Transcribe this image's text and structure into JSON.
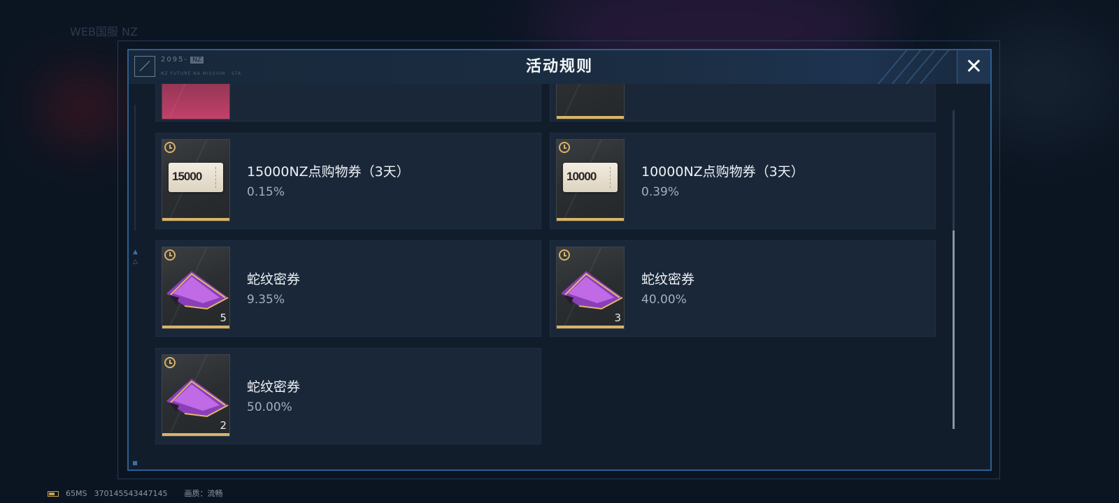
{
  "background": {
    "hint_text": "WEB国服 NZ"
  },
  "dialog": {
    "logo_text": "2095-",
    "logo_tag": "NZ",
    "logo_sub": "NZ FUTURE NA MISSION · STA",
    "title": "活动规则",
    "close_icon": "close-icon"
  },
  "rewards": [
    {
      "name": "15000NZ点购物券（3天）",
      "rate": "0.15%",
      "icon": "voucher-15000",
      "voucher_text": "15000"
    },
    {
      "name": "10000NZ点购物券（3天）",
      "rate": "0.39%",
      "icon": "voucher-10000",
      "voucher_text": "10000"
    },
    {
      "name": "蛇纹密券",
      "rate": "9.35%",
      "icon": "snake-coupon",
      "qty": "5"
    },
    {
      "name": "蛇纹密券",
      "rate": "40.00%",
      "icon": "snake-coupon",
      "qty": "3"
    },
    {
      "name": "蛇纹密券",
      "rate": "50.00%",
      "icon": "snake-coupon",
      "qty": "2"
    }
  ],
  "colors": {
    "accent_gold": "#d8b46a",
    "border_blue": "#2c5f93",
    "rate_text": "#9fb0c2",
    "coupon_purple": "#a64fd4"
  },
  "status_bar": {
    "ping": "65MS",
    "id": "370145543447145",
    "quality": "画质：流畅"
  }
}
